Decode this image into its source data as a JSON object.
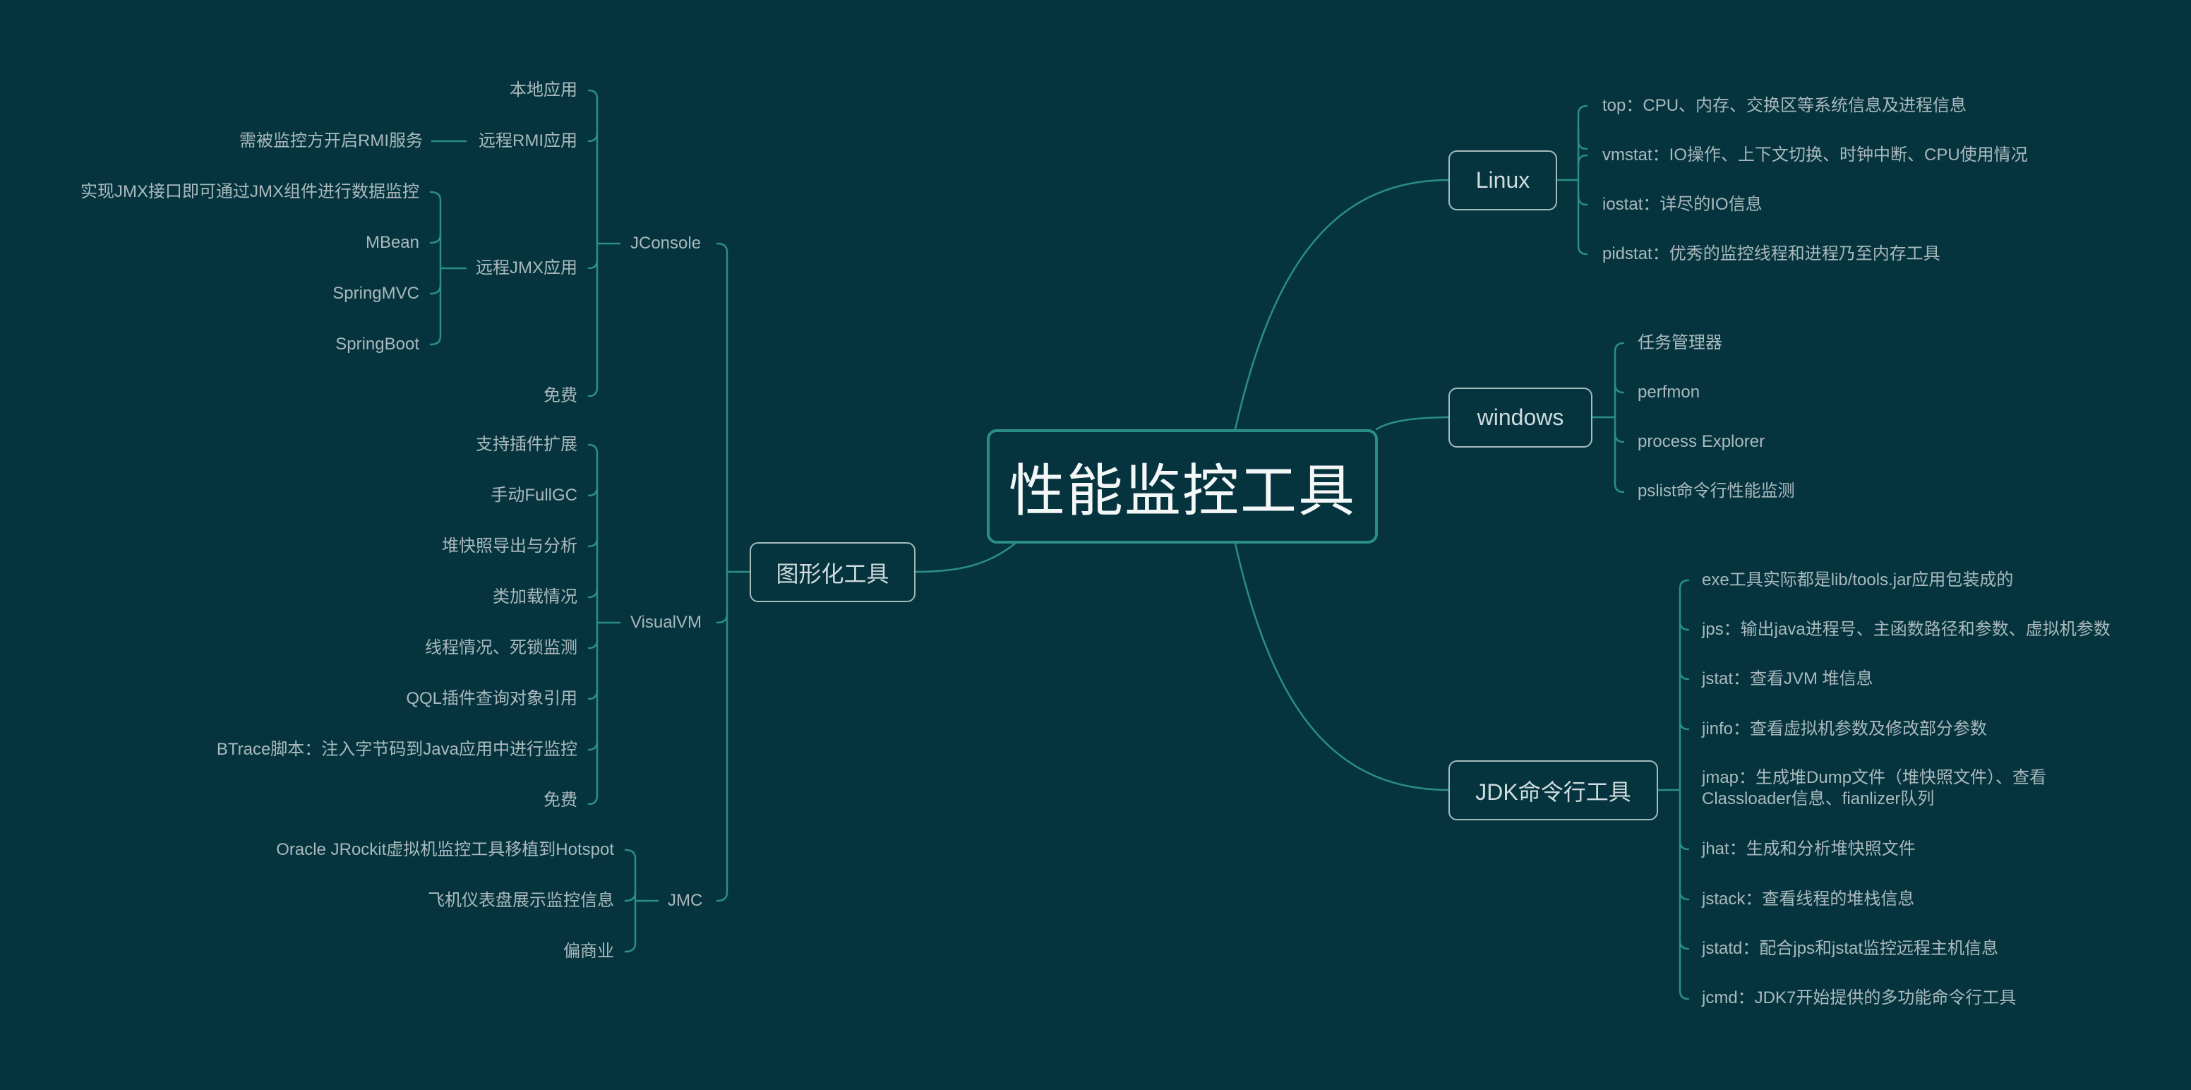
{
  "colors": {
    "background": "#05343f",
    "connector": "#2b8e86",
    "text": "#aab9bd",
    "node_border": "#a5bcbf"
  },
  "root": "性能监控工具",
  "graphical": {
    "label": "图形化工具",
    "jconsole": {
      "label": "JConsole",
      "local": "本地应用",
      "rmi": {
        "label": "远程RMI应用",
        "note": "需被监控方开启RMI服务"
      },
      "jmx": {
        "label": "远程JMX应用",
        "items": [
          "实现JMX接口即可通过JMX组件进行数据监控",
          "MBean",
          "SpringMVC",
          "SpringBoot"
        ]
      },
      "free": "免费"
    },
    "visualvm": {
      "label": "VisualVM",
      "items": [
        "支持插件扩展",
        "手动FullGC",
        "堆快照导出与分析",
        "类加载情况",
        "线程情况、死锁监测",
        "QQL插件查询对象引用",
        "BTrace脚本：注入字节码到Java应用中进行监控",
        "免费"
      ]
    },
    "jmc": {
      "label": "JMC",
      "items": [
        "Oracle JRockit虚拟机监控工具移植到Hotspot",
        "飞机仪表盘展示监控信息",
        "偏商业"
      ]
    }
  },
  "linux": {
    "label": "Linux",
    "items": [
      "top：CPU、内存、交换区等系统信息及进程信息",
      "vmstat：IO操作、上下文切换、时钟中断、CPU使用情况",
      "iostat：详尽的IO信息",
      "pidstat：优秀的监控线程和进程乃至内存工具"
    ]
  },
  "windows": {
    "label": "windows",
    "items": [
      "任务管理器",
      "perfmon",
      "process Explorer",
      "pslist命令行性能监测"
    ]
  },
  "jdk": {
    "label": "JDK命令行工具",
    "items": [
      "exe工具实际都是lib/tools.jar应用包装成的",
      "jps：输出java进程号、主函数路径和参数、虚拟机参数",
      "jstat：查看JVM 堆信息",
      "jinfo：查看虚拟机参数及修改部分参数",
      "jmap：生成堆Dump文件（堆快照文件）、查看Classloader信息、fianlizer队列",
      "jhat：生成和分析堆快照文件",
      "jstack：查看线程的堆栈信息",
      "jstatd：配合jps和jstat监控远程主机信息",
      "jcmd：JDK7开始提供的多功能命令行工具"
    ]
  }
}
